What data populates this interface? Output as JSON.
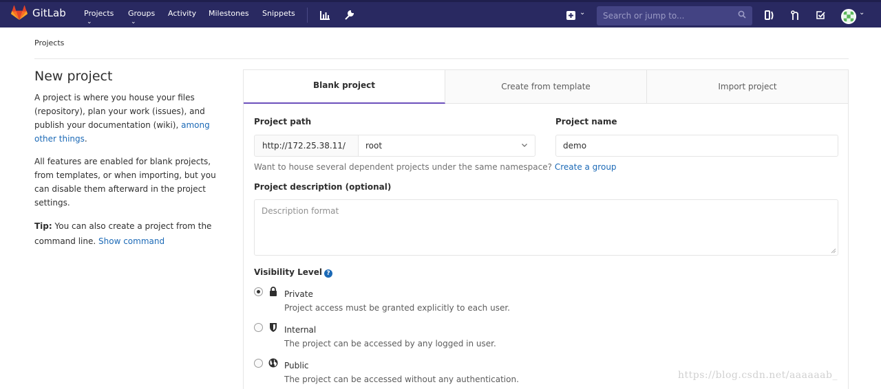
{
  "app": {
    "name": "GitLab",
    "brand_color": "#292961",
    "accent": "#6b4fbb",
    "link_color": "#1b69b6"
  },
  "nav": {
    "items": [
      {
        "label": "Projects",
        "dropdown": true
      },
      {
        "label": "Groups",
        "dropdown": true
      },
      {
        "label": "Activity"
      },
      {
        "label": "Milestones"
      },
      {
        "label": "Snippets"
      }
    ],
    "icons": [
      "chart-icon",
      "wrench-icon"
    ],
    "search_placeholder": "Search or jump to...",
    "right_icons": [
      "plus-square-icon",
      "issues-icon",
      "merge-request-icon",
      "todo-icon",
      "avatar"
    ]
  },
  "breadcrumb": "Projects",
  "left": {
    "title": "New project",
    "intro_text": "A project is where you house your files (repository), plan your work (issues), and publish your documentation (wiki), ",
    "intro_link": "among other things",
    "intro_end": ".",
    "features": "All features are enabled for blank projects, from templates, or when importing, but you can disable them afterward in the project settings.",
    "tip_label": "Tip:",
    "tip_text": " You can also create a project from the command line. ",
    "tip_link": "Show command"
  },
  "tabs": [
    {
      "label": "Blank project",
      "active": true
    },
    {
      "label": "Create from template"
    },
    {
      "label": "Import project"
    }
  ],
  "form": {
    "path_label": "Project path",
    "path_prefix": "http://172.25.38.11/",
    "namespace": "root",
    "name_label": "Project name",
    "name_value": "demo",
    "help_text": "Want to house several dependent projects under the same namespace? ",
    "help_link": "Create a group",
    "desc_label": "Project description (optional)",
    "desc_placeholder": "Description format",
    "visibility_label": "Visibility Level",
    "visibility": [
      {
        "title": "Private",
        "desc": "Project access must be granted explicitly to each user.",
        "checked": true,
        "icon": "lock-icon"
      },
      {
        "title": "Internal",
        "desc": "The project can be accessed by any logged in user.",
        "checked": false,
        "icon": "shield-icon"
      },
      {
        "title": "Public",
        "desc": "The project can be accessed without any authentication.",
        "checked": false,
        "icon": "globe-icon"
      }
    ]
  },
  "watermark": "https://blog.csdn.net/aaaaaab_"
}
